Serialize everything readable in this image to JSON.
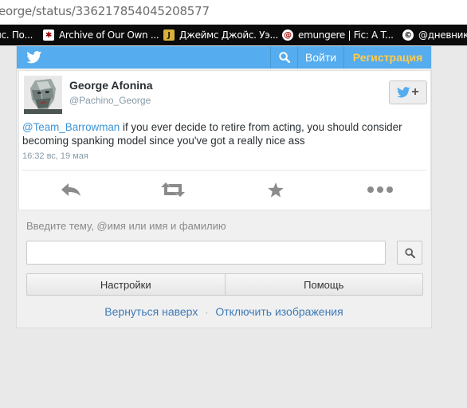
{
  "browser": {
    "url": "eorge/status/336217854045208577",
    "bookmarks": [
      {
        "label": "йс. По...",
        "icon": "blank-page-icon"
      },
      {
        "label": "Archive of Our Own ...",
        "icon": "ao3-icon"
      },
      {
        "label": "Джеймс Джойс. Уэ...",
        "icon": "j-icon"
      },
      {
        "label": "emungere | Fic: A T...",
        "icon": "livejournal-icon"
      },
      {
        "label": "@дневники",
        "icon": "copyright-icon"
      }
    ]
  },
  "header": {
    "login_label": "Войти",
    "signup_label": "Регистрация",
    "brand_color": "#55acee",
    "signup_color": "#ffcc4d"
  },
  "tweet": {
    "author_name": "George Afonina",
    "author_handle": "@Pachino_George",
    "mention": "@Team_Barrowman",
    "text": " if you ever decide to retire from acting, you should consider becoming spanking model since you've got a really nice ass",
    "timestamp": "16:32 вс, 19 мая",
    "follow_label": "+"
  },
  "search": {
    "hint": "Введите тему, @имя или имя и фамилию",
    "value": "",
    "placeholder": ""
  },
  "buttons": {
    "settings_label": "Настройки",
    "help_label": "Помощь"
  },
  "footer": {
    "back_to_top": "Вернуться наверх",
    "separator": "·",
    "disable_images": "Отключить изображения"
  }
}
